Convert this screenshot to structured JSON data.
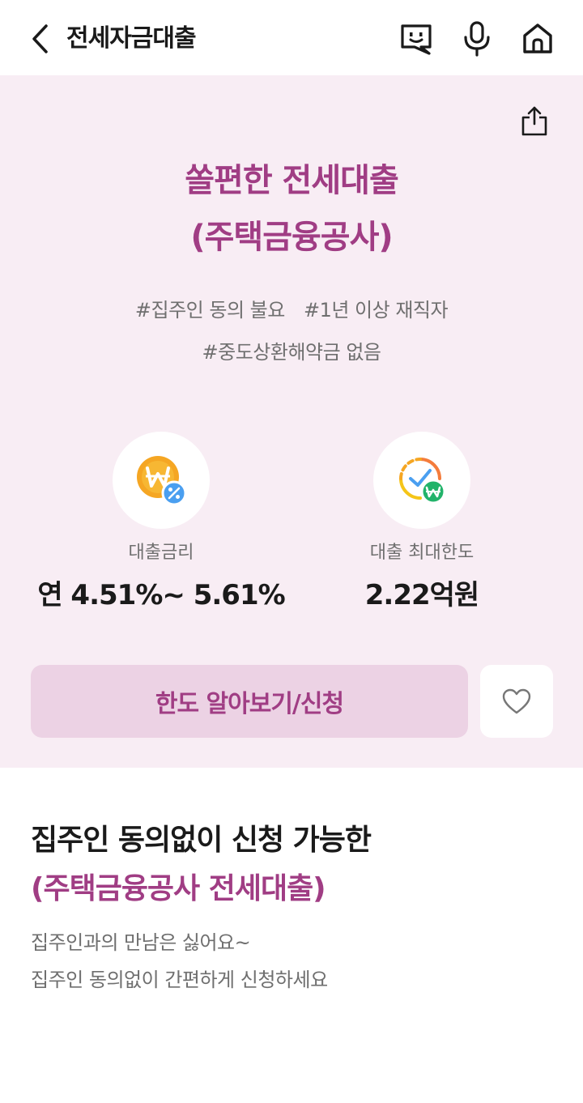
{
  "header": {
    "title": "전세자금대출",
    "icons": [
      "back-arrow-icon",
      "chatbot-icon",
      "microphone-icon",
      "home-icon"
    ]
  },
  "hero": {
    "share_icon": "share-icon",
    "title_line1": "쏠편한 전세대출",
    "title_line2": "(주택금융공사)",
    "tags_row1": [
      "#집주인 동의 불요",
      "#1년 이상 재직자"
    ],
    "tags_row2": [
      "#중도상환해약금 없음"
    ],
    "stats": [
      {
        "icon": "won-percent-icon",
        "label": "대출금리",
        "value": "연 4.51%~ 5.61%"
      },
      {
        "icon": "won-check-gauge-icon",
        "label": "대출 최대한도",
        "value": "2.22억원"
      }
    ],
    "apply_label": "한도 알아보기/신청",
    "favorite_icon": "heart-icon"
  },
  "section": {
    "title_line1": "집주인 동의없이 신청 가능한",
    "title_line2": "(주택금융공사 전세대출)",
    "desc_line1": "집주인과의 만남은 싫어요~",
    "desc_line2": "집주인 동의없이 간편하게 신청하세요"
  },
  "colors": {
    "accent": "#a03d84",
    "hero_bg": "#f8edf4",
    "button_bg": "#ecd2e4",
    "coin_yellow": "#f5a623",
    "badge_blue": "#4a9ff0",
    "badge_green": "#22b36a"
  }
}
